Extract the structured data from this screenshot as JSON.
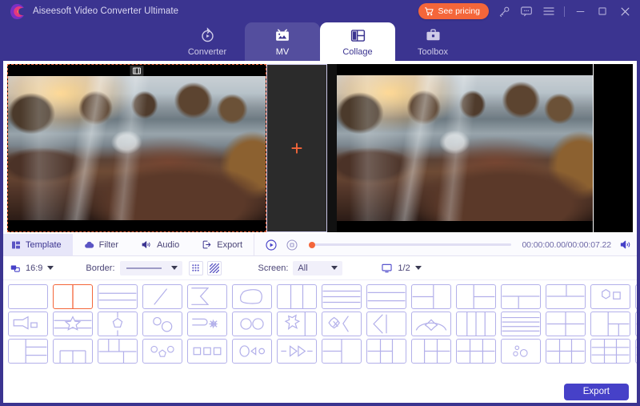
{
  "titlebar": {
    "app_title": "Aiseesoft Video Converter Ultimate",
    "logo_icon": "aiseesoft-logo-icon",
    "pricing_label": "See pricing",
    "cart_icon": "cart-icon",
    "key_icon": "key-icon",
    "feedback_icon": "feedback-chat-icon",
    "menu_icon": "hamburger-menu-icon",
    "minimize_icon": "minimize-icon",
    "maximize_icon": "maximize-icon",
    "close_icon": "close-icon"
  },
  "nav": {
    "tabs": [
      {
        "label": "Converter",
        "icon": "converter-refresh-play-icon",
        "state": "normal"
      },
      {
        "label": "MV",
        "icon": "mv-picture-frame-icon",
        "state": "semi"
      },
      {
        "label": "Collage",
        "icon": "collage-layout-icon",
        "state": "active"
      },
      {
        "label": "Toolbox",
        "icon": "toolbox-briefcase-icon",
        "state": "normal"
      }
    ]
  },
  "preview": {
    "pane_a_name": "video-pane-left",
    "pane_a_badge_icon": "film-strip-icon",
    "pane_middle_name": "add-media-pane",
    "add_icon": "plus-icon",
    "pane_b_name": "video-pane-right",
    "selection_color": "#f4663a"
  },
  "subbar": {
    "tabs": [
      {
        "label": "Template",
        "icon": "template-grid-icon",
        "active": true
      },
      {
        "label": "Filter",
        "icon": "filter-cloud-icon",
        "active": false
      },
      {
        "label": "Audio",
        "icon": "audio-speaker-icon",
        "active": false
      },
      {
        "label": "Export",
        "icon": "export-arrow-icon",
        "active": false
      }
    ]
  },
  "playback": {
    "play_icon": "play-circle-icon",
    "stop_icon": "stop-square-icon",
    "progress_percent": 0,
    "timecode": "00:00:00.00/00:00:07.22",
    "current_time": "00:00:00.00",
    "total_time": "00:00:07.22",
    "volume_icon": "volume-speaker-icon"
  },
  "options": {
    "ratio_icon": "aspect-ratio-icon",
    "ratio_value": "16:9",
    "border_label": "Border:",
    "border_style_value": "solid-line",
    "border_dots_icon": "border-dots-icon",
    "border_stripes_icon": "border-stripes-icon",
    "screen_label": "Screen:",
    "screen_value": "All",
    "monitor_icon": "monitor-icon",
    "screen_count": "1/2"
  },
  "templates": {
    "selected_index": 1,
    "rows": [
      [
        {
          "name": "tmpl-single"
        },
        {
          "name": "tmpl-2-col"
        },
        {
          "name": "tmpl-2-row"
        },
        {
          "name": "tmpl-diagonal"
        },
        {
          "name": "tmpl-chevron"
        },
        {
          "name": "tmpl-blob"
        },
        {
          "name": "tmpl-3-col"
        },
        {
          "name": "tmpl-3-row"
        },
        {
          "name": "tmpl-3-row-b"
        },
        {
          "name": "tmpl-left-split-top"
        },
        {
          "name": "tmpl-left-half-right-split"
        },
        {
          "name": "tmpl-top-bar-bottom-split"
        },
        {
          "name": "tmpl-top-split-bottom-bar"
        },
        {
          "name": "tmpl-hexagon-square"
        },
        {
          "name": "tmpl-puzzle"
        },
        {
          "name": "tmpl-two-hearts"
        }
      ],
      [
        {
          "name": "tmpl-megaphone"
        },
        {
          "name": "tmpl-star-band"
        },
        {
          "name": "tmpl-pentagon-center"
        },
        {
          "name": "tmpl-two-circles"
        },
        {
          "name": "tmpl-flag-gear"
        },
        {
          "name": "tmpl-double-circle"
        },
        {
          "name": "tmpl-starburst-split"
        },
        {
          "name": "tmpl-knot-arrow"
        },
        {
          "name": "tmpl-arrow-left"
        },
        {
          "name": "tmpl-arch-diamond"
        },
        {
          "name": "tmpl-4-col"
        },
        {
          "name": "tmpl-4-row"
        },
        {
          "name": "tmpl-2x2-grid"
        },
        {
          "name": "tmpl-left-col-right-2"
        },
        {
          "name": "tmpl-top-row-bottom-split"
        },
        {
          "name": "tmpl-rows-left-right-pane"
        }
      ],
      [
        {
          "name": "tmpl-left-pane-right-rows"
        },
        {
          "name": "tmpl-bottom-thirds"
        },
        {
          "name": "tmpl-top-thirds"
        },
        {
          "name": "tmpl-circles-pentagon"
        },
        {
          "name": "tmpl-three-squares"
        },
        {
          "name": "tmpl-oval-triangle"
        },
        {
          "name": "tmpl-double-arrow"
        },
        {
          "name": "tmpl-split-col-grid"
        },
        {
          "name": "tmpl-half-grid"
        },
        {
          "name": "tmpl-grid-right-pane"
        },
        {
          "name": "tmpl-left-pane-grid"
        },
        {
          "name": "tmpl-bubbles"
        },
        {
          "name": "tmpl-2x3-grid"
        },
        {
          "name": "tmpl-3x3-grid"
        },
        {
          "name": "tmpl-mixed-grid"
        },
        {
          "name": "tmpl-complex-grid"
        }
      ]
    ]
  },
  "footer": {
    "export_label": "Export"
  },
  "colors": {
    "brand_purple": "#3b3490",
    "accent_orange": "#f4663a",
    "export_blue": "#4641c8",
    "template_outline": "#b3b0ea"
  }
}
